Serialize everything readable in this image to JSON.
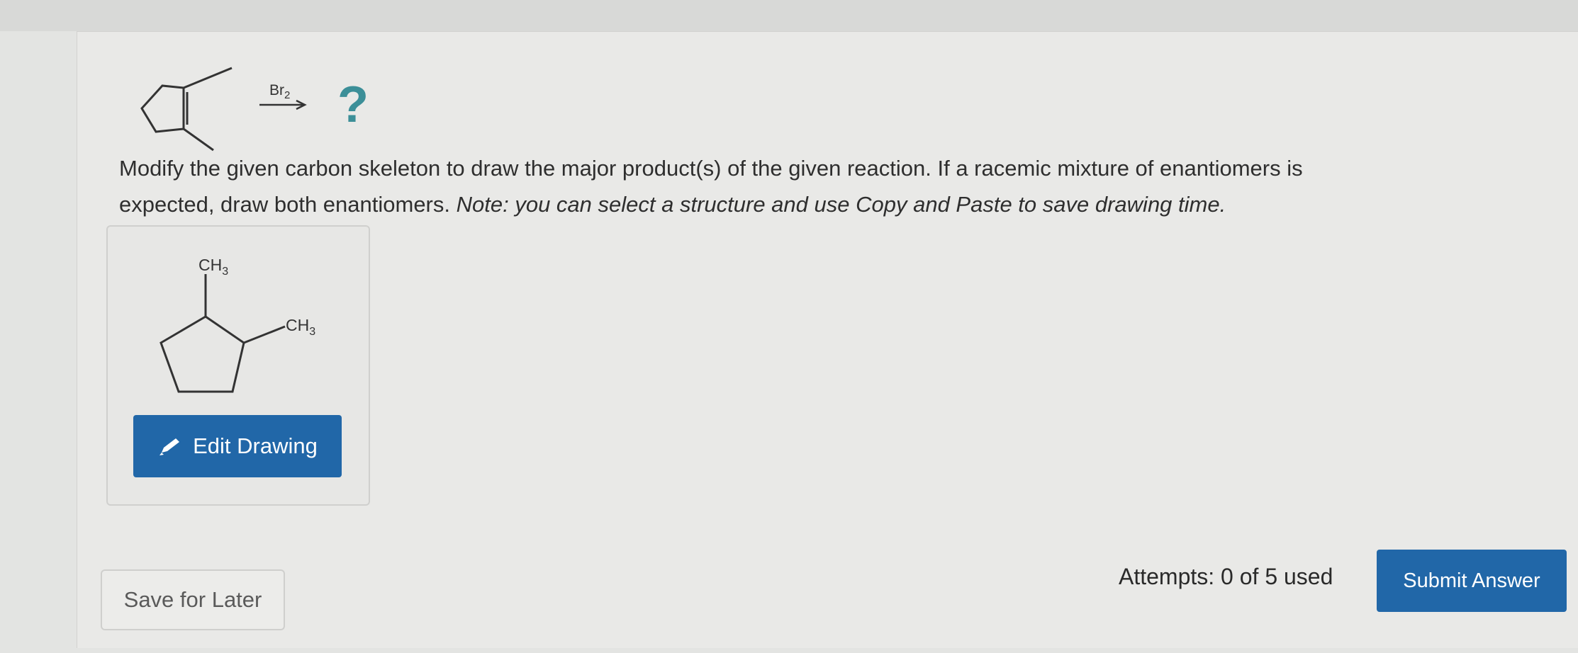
{
  "reaction": {
    "reagent_main": "Br",
    "reagent_sub": "2",
    "unknown_product": "?"
  },
  "question": {
    "line1": "Modify the given carbon skeleton to draw the major product(s) of the given reaction. If a racemic mixture of enantiomers is",
    "line2_normal": "expected, draw both enantiomers. ",
    "line2_italic": "Note: you can select a structure and use Copy and Paste to save drawing time."
  },
  "drawing": {
    "label_top_main": "CH",
    "label_top_sub": "3",
    "label_right_main": "CH",
    "label_right_sub": "3",
    "edit_label": "Edit Drawing",
    "edit_icon": "pencil-icon"
  },
  "footer": {
    "save_label": "Save for Later",
    "attempts_text": "Attempts: 0 of 5 used",
    "submit_label": "Submit Answer"
  },
  "colors": {
    "button_blue": "#2167a8",
    "question_mark_teal": "#3c8f98"
  }
}
